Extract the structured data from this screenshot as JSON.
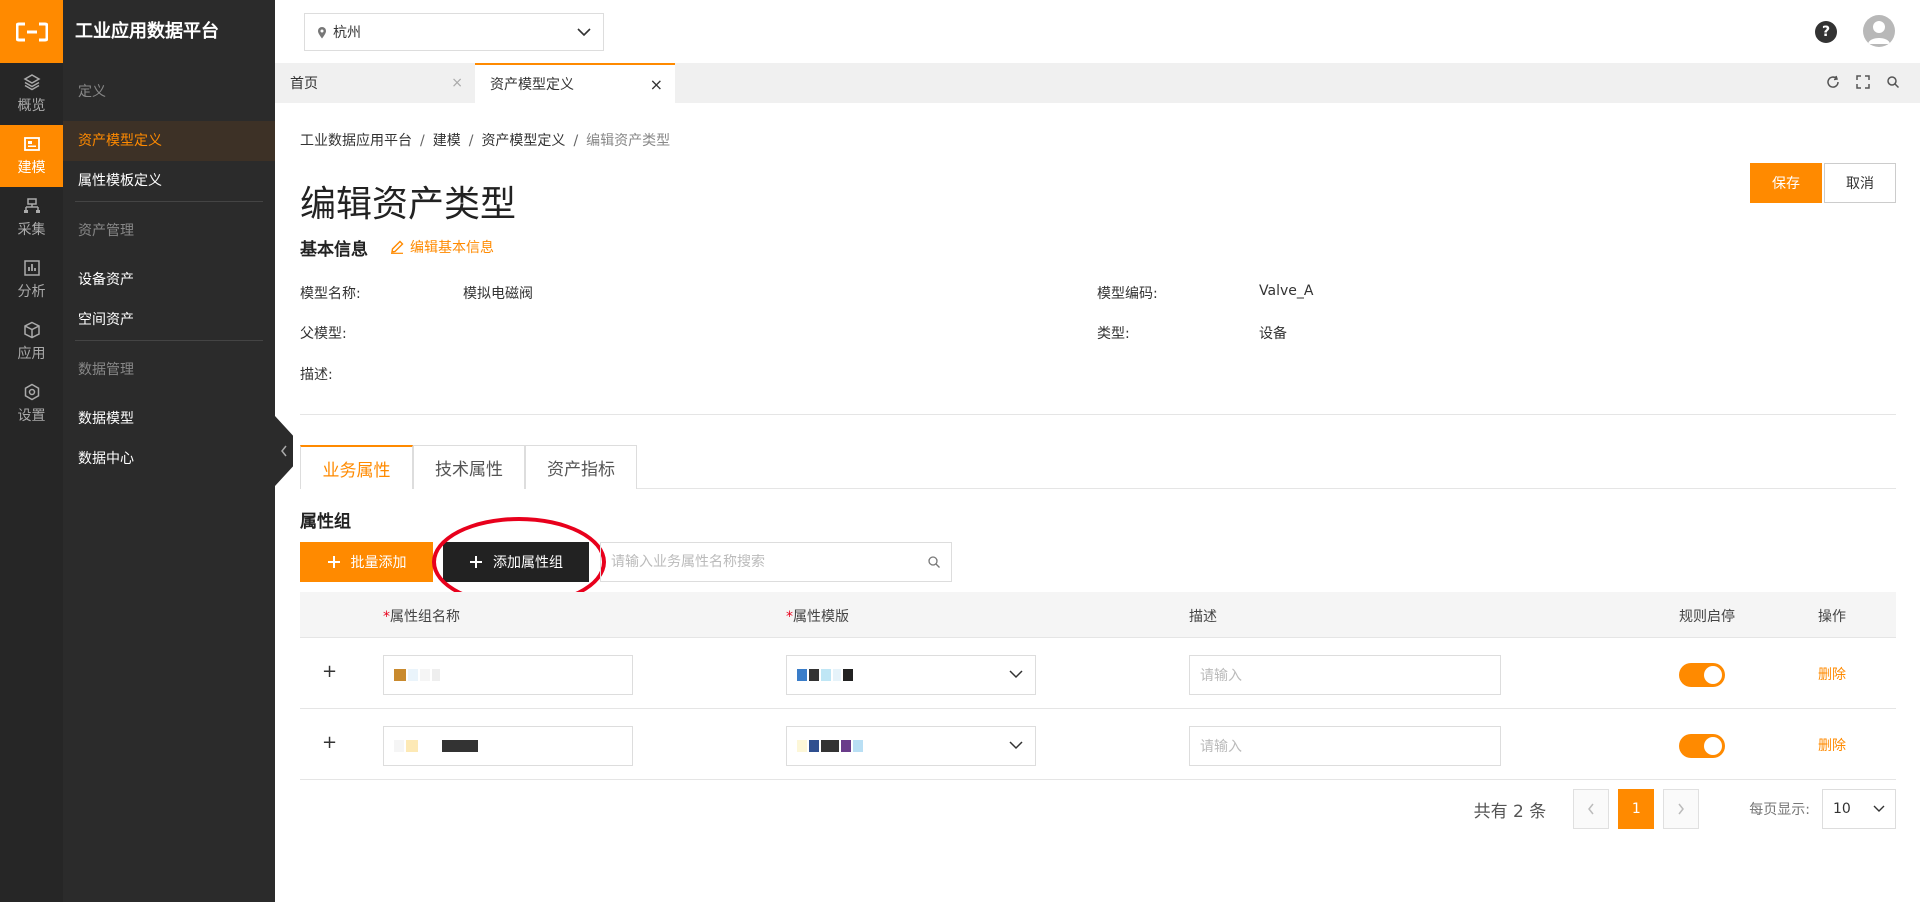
{
  "app": {
    "title": "工业应用数据平台",
    "accent": "#ff8a00",
    "highlight": "#e8001c"
  },
  "rail": [
    {
      "label": "概览",
      "icon": "layers-icon",
      "active": false
    },
    {
      "label": "建模",
      "icon": "modeling-icon",
      "active": true
    },
    {
      "label": "采集",
      "icon": "collect-icon",
      "active": false
    },
    {
      "label": "分析",
      "icon": "chart-icon",
      "active": false
    },
    {
      "label": "应用",
      "icon": "cube-icon",
      "active": false
    },
    {
      "label": "设置",
      "icon": "gear-icon",
      "active": false
    }
  ],
  "sidebar": {
    "sections": [
      {
        "title": "定义",
        "items": [
          "资产模型定义",
          "属性模板定义"
        ]
      },
      {
        "title": "资产管理",
        "items": [
          "设备资产",
          "空间资产"
        ]
      },
      {
        "title": "数据管理",
        "items": [
          "数据模型",
          "数据中心"
        ]
      }
    ]
  },
  "topbar": {
    "city": "杭州",
    "help": "?"
  },
  "page_tabs": [
    {
      "label": "首页",
      "close": "×"
    },
    {
      "label": "资产模型定义",
      "close": "×"
    }
  ],
  "breadcrumb": [
    "工业数据应用平台",
    "建模",
    "资产模型定义",
    "编辑资产类型"
  ],
  "page_title": "编辑资产类型",
  "buttons": {
    "save": "保存",
    "cancel": "取消"
  },
  "basic_info": {
    "title": "基本信息",
    "edit_link": "编辑基本信息",
    "model_name_label": "模型名称:",
    "model_name": "模拟电磁阀",
    "model_code_label": "模型编码:",
    "model_code": "Valve_A",
    "parent_label": "父模型:",
    "parent": "",
    "type_label": "类型:",
    "type": "设备",
    "desc_label": "描述:",
    "desc": ""
  },
  "attr_tabs": [
    "业务属性",
    "技术属性",
    "资产指标"
  ],
  "group": {
    "title": "属性组",
    "batch_add": "批量添加",
    "add_group": "添加属性组",
    "search_placeholder": "请输入业务属性名称搜索"
  },
  "table": {
    "columns": {
      "name": "属性组名称",
      "template": "属性模版",
      "desc": "描述",
      "rule": "规则启停",
      "action": "操作"
    },
    "required_mark": "*",
    "expand": "+",
    "desc_placeholder": "请输入",
    "delete": "删除",
    "rows": [
      {
        "enabled": true
      },
      {
        "enabled": true
      }
    ]
  },
  "pagination": {
    "total": "共有 2 条",
    "current_page": "1",
    "per_page_label": "每页显示:",
    "per_page": "10"
  }
}
